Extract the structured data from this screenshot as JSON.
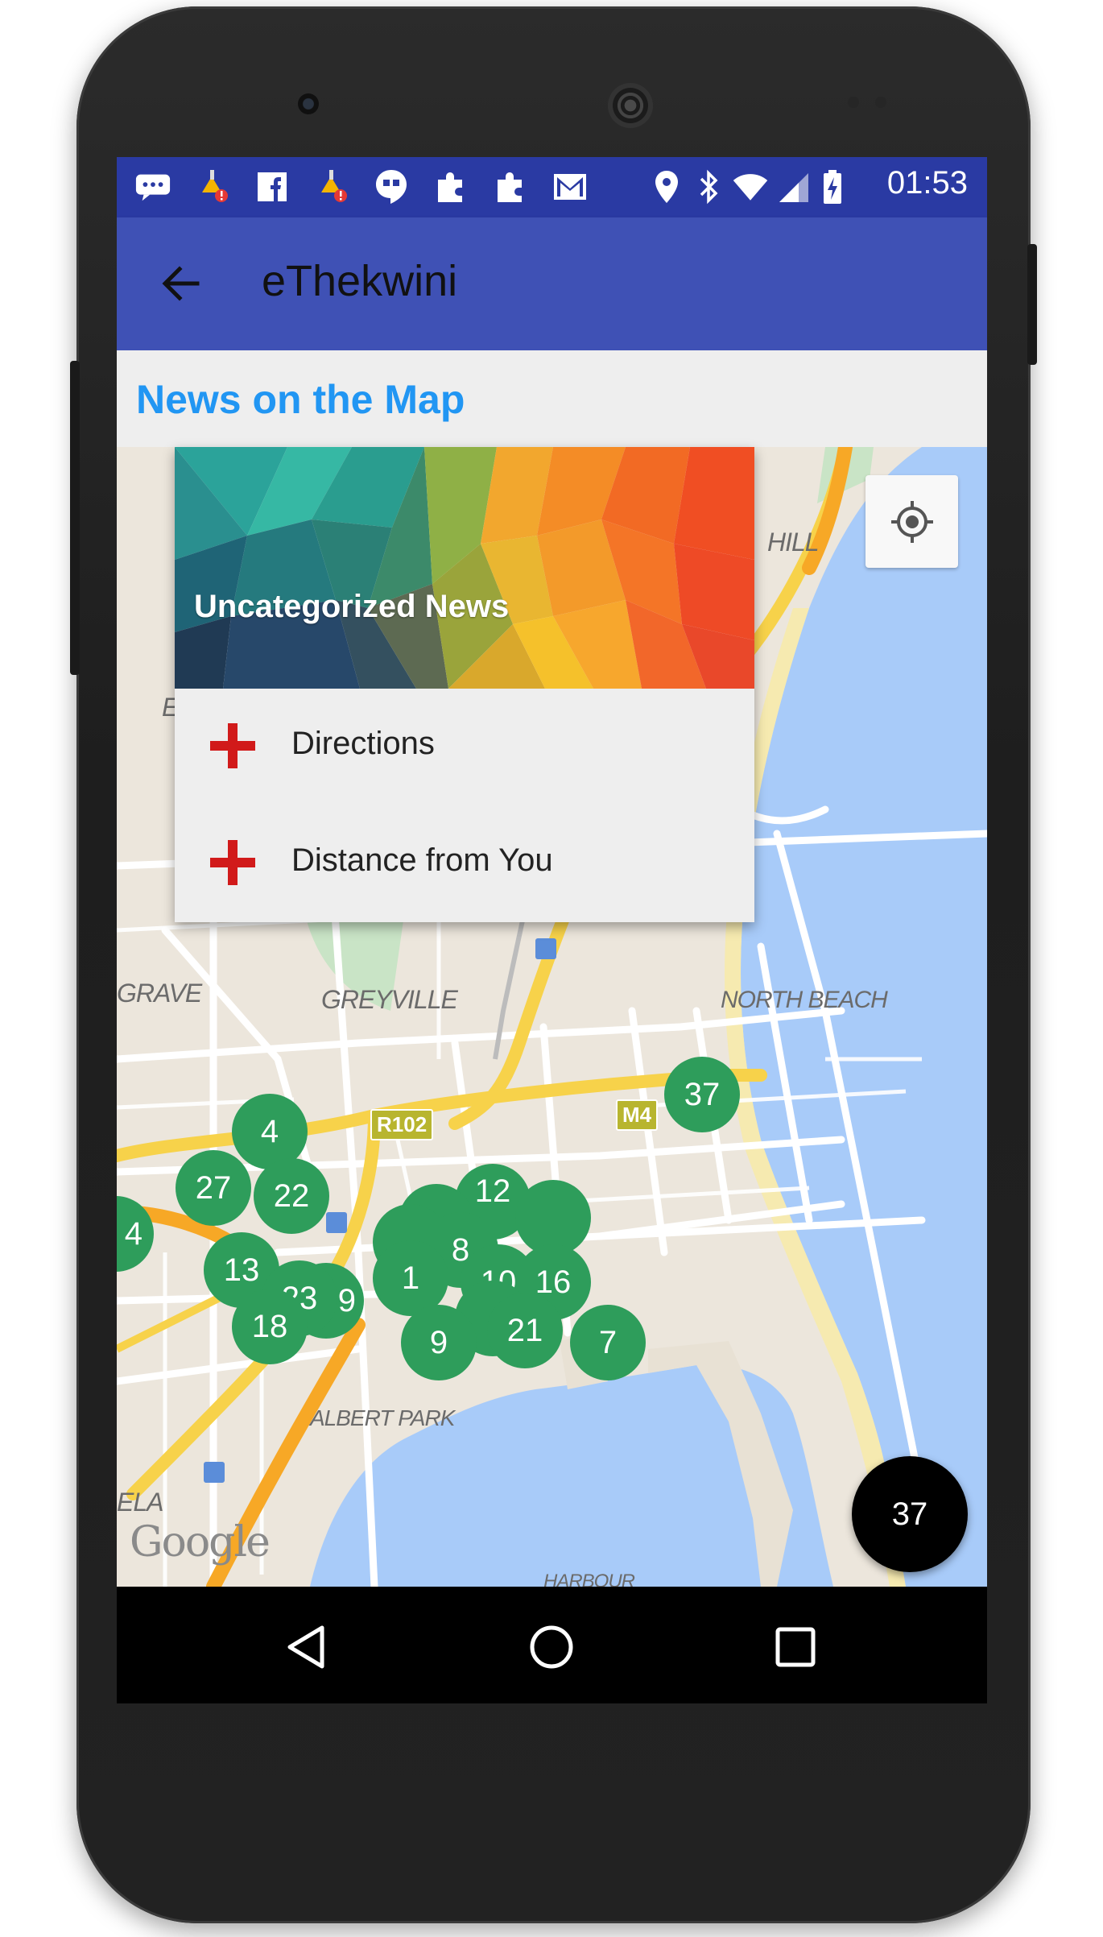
{
  "status_bar": {
    "time": "01:53",
    "icons": [
      "message-icon",
      "cleaner-alert-icon",
      "facebook-icon",
      "cleaner-alert-icon",
      "hangouts-icon",
      "puzzle-icon",
      "puzzle-icon",
      "gmail-icon",
      "location-icon",
      "bluetooth-icon",
      "wifi-icon",
      "signal-icon",
      "battery-charging-icon"
    ]
  },
  "app_bar": {
    "title": "eThekwini",
    "back_icon": "arrow-back-icon"
  },
  "section": {
    "title": "News on the Map"
  },
  "map": {
    "labels": {
      "hill": "HILL",
      "grave": "GRAVE",
      "greyville": "GREYVILLE",
      "north_beach": "NORTH BEACH",
      "albert_park": "ALBERT PARK",
      "ela": "ELA",
      "harbour": "HARBOUR",
      "e_fragment": "E"
    },
    "road_shields": {
      "r102": "R102",
      "m4": "M4"
    },
    "clusters": {
      "c4": "4",
      "c27": "27",
      "c22": "22",
      "c13": "13",
      "c23": "23",
      "c9a": "9",
      "c18": "18",
      "c1": "1",
      "c12": "12",
      "c8": "8",
      "c10": "10",
      "c16": "16",
      "c21": "21",
      "c9": "9",
      "c7": "7",
      "c37": "37",
      "c4edge": "4"
    },
    "attribution": "Google"
  },
  "popup": {
    "title": "Uncategorized News",
    "items": [
      {
        "label": "Directions"
      },
      {
        "label": "Distance from You"
      }
    ]
  },
  "fab": {
    "count": "37"
  },
  "colors": {
    "primary": "#3f51b5",
    "status_bar": "#2a3aa3",
    "section_title": "#2196f3",
    "cluster_green": "#2e9d5b",
    "plus_red": "#d11a1a"
  }
}
